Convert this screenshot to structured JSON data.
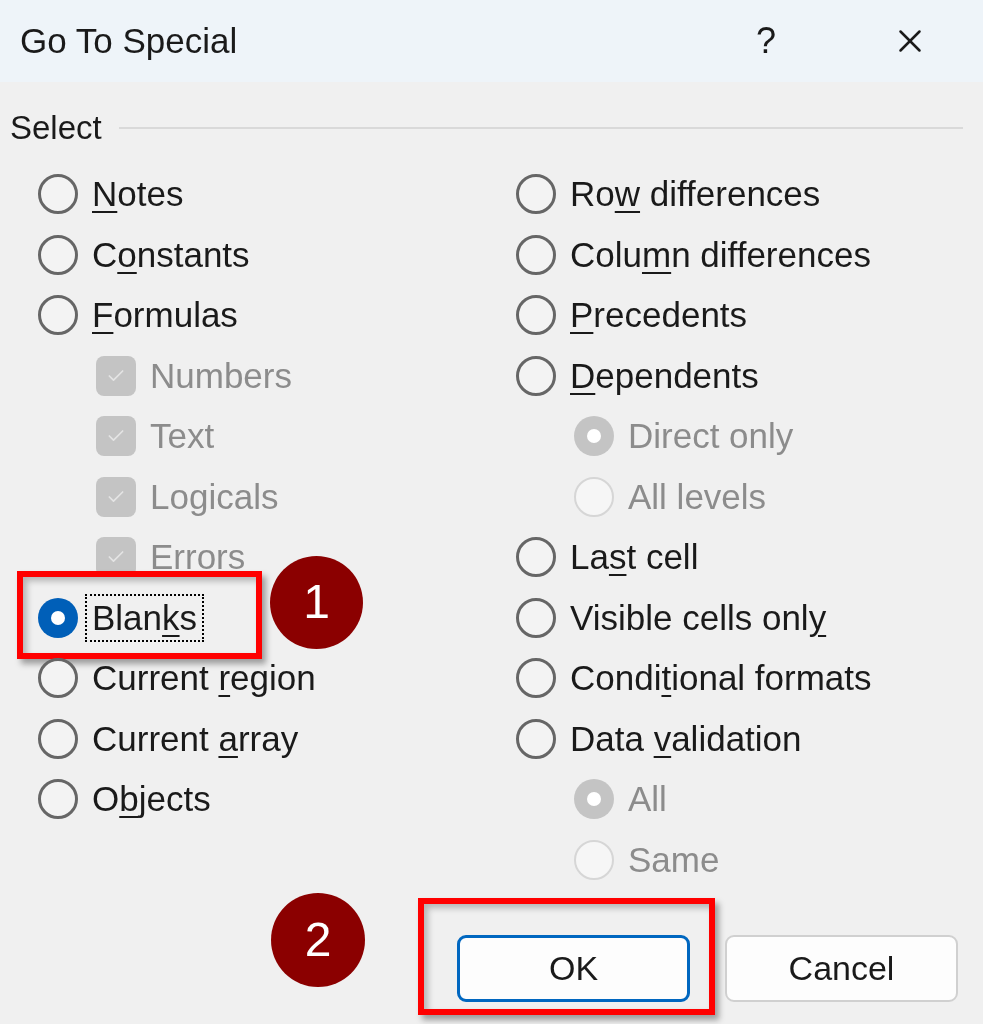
{
  "window": {
    "title": "Go To Special",
    "help_label": "?"
  },
  "group": {
    "label": "Select"
  },
  "left_options": [
    {
      "kind": "radio",
      "label": {
        "key": "N",
        "end": "otes"
      },
      "selected": false,
      "disabled": false,
      "focused": false,
      "highlighted": false
    },
    {
      "kind": "radio",
      "label": {
        "start": "C",
        "key": "o",
        "end": "nstants"
      },
      "selected": false,
      "disabled": false,
      "focused": false,
      "highlighted": false
    },
    {
      "kind": "radio",
      "label": {
        "key": "F",
        "end": "ormulas"
      },
      "selected": false,
      "disabled": false,
      "focused": false,
      "highlighted": false,
      "children": [
        {
          "kind": "checkbox",
          "label": {
            "start": "Numbers"
          },
          "checked": true,
          "disabled": true
        },
        {
          "kind": "checkbox",
          "label": {
            "start": "Text"
          },
          "checked": true,
          "disabled": true
        },
        {
          "kind": "checkbox",
          "label": {
            "start": "Logicals"
          },
          "checked": true,
          "disabled": true
        },
        {
          "kind": "checkbox",
          "label": {
            "start": "Errors"
          },
          "checked": true,
          "disabled": true
        }
      ]
    },
    {
      "kind": "radio",
      "label": {
        "start": "Blan",
        "key": "k",
        "end": "s"
      },
      "selected": true,
      "disabled": false,
      "focused": true,
      "highlighted": true,
      "callout": "1"
    },
    {
      "kind": "radio",
      "label": {
        "start": "Current ",
        "key": "r",
        "end": "egion"
      },
      "selected": false,
      "disabled": false,
      "focused": false,
      "highlighted": false
    },
    {
      "kind": "radio",
      "label": {
        "start": "Current ",
        "key": "a",
        "end": "rray"
      },
      "selected": false,
      "disabled": false,
      "focused": false,
      "highlighted": false
    },
    {
      "kind": "radio",
      "label": {
        "start": "O",
        "key": "b",
        "end": "jects"
      },
      "selected": false,
      "disabled": false,
      "focused": false,
      "highlighted": false
    }
  ],
  "right_options": [
    {
      "kind": "radio",
      "label": {
        "start": "Ro",
        "key": "w",
        "end": " differences"
      },
      "selected": false,
      "disabled": false,
      "focused": false,
      "highlighted": false
    },
    {
      "kind": "radio",
      "label": {
        "start": "Colu",
        "key": "m",
        "end": "n differences"
      },
      "selected": false,
      "disabled": false,
      "focused": false,
      "highlighted": false
    },
    {
      "kind": "radio",
      "label": {
        "key": "P",
        "end": "recedents"
      },
      "selected": false,
      "disabled": false,
      "focused": false,
      "highlighted": false
    },
    {
      "kind": "radio",
      "label": {
        "key": "D",
        "end": "ependents"
      },
      "selected": false,
      "disabled": false,
      "focused": false,
      "highlighted": false,
      "children": [
        {
          "kind": "radio",
          "label": {
            "start": "Direct only"
          },
          "selected": true,
          "disabled": true
        },
        {
          "kind": "radio",
          "label": {
            "start": "All levels"
          },
          "selected": false,
          "disabled": true
        }
      ]
    },
    {
      "kind": "radio",
      "label": {
        "start": "La",
        "key": "s",
        "end": "t cell"
      },
      "selected": false,
      "disabled": false,
      "focused": false,
      "highlighted": false
    },
    {
      "kind": "radio",
      "label": {
        "start": "Visible cells onl",
        "key": "y"
      },
      "selected": false,
      "disabled": false,
      "focused": false,
      "highlighted": false
    },
    {
      "kind": "radio",
      "label": {
        "start": "Condi",
        "key": "t",
        "end": "ional formats"
      },
      "selected": false,
      "disabled": false,
      "focused": false,
      "highlighted": false
    },
    {
      "kind": "radio",
      "label": {
        "start": "Data ",
        "key": "v",
        "end": "alidation"
      },
      "selected": false,
      "disabled": false,
      "focused": false,
      "highlighted": false,
      "children": [
        {
          "kind": "radio",
          "label": {
            "start": "All"
          },
          "selected": true,
          "disabled": true
        },
        {
          "kind": "radio",
          "label": {
            "start": "Same"
          },
          "selected": false,
          "disabled": true
        }
      ]
    }
  ],
  "buttons": [
    {
      "label": "OK",
      "default": true,
      "highlighted": true,
      "callout": "2"
    },
    {
      "label": "Cancel",
      "default": false,
      "highlighted": false
    }
  ]
}
